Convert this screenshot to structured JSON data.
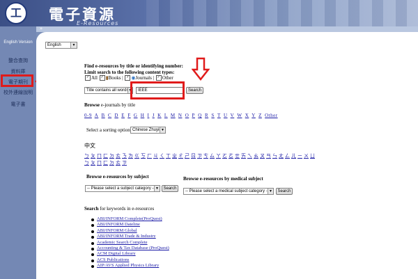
{
  "header": {
    "logo_glyph": "工",
    "title_zh": "電子資源",
    "title_en": "E-Resources"
  },
  "sidebar": {
    "english_version": "English Version",
    "items": [
      {
        "label": "整合查詢"
      },
      {
        "label": "資料庫"
      },
      {
        "label": "電子期刊"
      },
      {
        "label": "校外連線說明"
      },
      {
        "label": "電子書"
      }
    ]
  },
  "language_select": {
    "value": "English"
  },
  "find": {
    "heading": "Find e-resources by title or identifying number:",
    "limit_label": "Limit search to the following content types:",
    "types": [
      "All",
      "Books",
      "Journals",
      "Other"
    ],
    "field_select": "Title contains all words",
    "query": "IEEE",
    "search_label": "Search"
  },
  "browse_title": {
    "heading_bold": "Browse",
    "heading_rest": " e-journals by title",
    "letters": [
      "0-9",
      "A",
      "B",
      "C",
      "D",
      "E",
      "F",
      "G",
      "H",
      "I",
      "J",
      "K",
      "L",
      "M",
      "N",
      "O",
      "P",
      "Q",
      "R",
      "S",
      "T",
      "U",
      "V",
      "W",
      "X",
      "Y",
      "Z",
      "Other"
    ]
  },
  "sorting": {
    "label": "Select a sorting option:",
    "value": "Chinese Zhuyin"
  },
  "zhuyin": {
    "heading": "中文",
    "row1": [
      "ㄅ",
      "ㄆ",
      "ㄇ",
      "ㄈ",
      "ㄉ",
      "ㄊ",
      "ㄋ",
      "ㄌ",
      "ㄍ",
      "ㄎ",
      "ㄏ",
      "ㄐ",
      "ㄑ",
      "ㄒ",
      "ㄓ",
      "ㄔ",
      "ㄕ",
      "ㄖ",
      "ㄗ",
      "ㄘ",
      "ㄙ",
      "ㄚ",
      "ㄛ",
      "ㄜ",
      "ㄝ",
      "ㄞ",
      "ㄟ",
      "ㄠ",
      "ㄡ",
      "ㄢ",
      "ㄣ",
      "ㄤ",
      "ㄥ",
      "ㄦ",
      "ㄧ",
      "ㄨ",
      "ㄩ"
    ],
    "row2": [
      "ㄅ",
      "ㄆ",
      "ㄇ",
      "ㄈ",
      "ㄉ",
      "ㄊ",
      "ㄗ"
    ]
  },
  "browse_subject": {
    "heading": "Browse e-resources by subject",
    "select": "-- Please select a subject category --",
    "search_label": "Search"
  },
  "browse_medical": {
    "heading": "Browse e-resources by medical subject",
    "select": "-- Please select a medical subject category --",
    "search_label": "Search"
  },
  "keywords": {
    "heading_bold": "Search",
    "heading_rest": " for keywords in e-resources",
    "items": [
      "ABI/INFORM Complete(ProQuest)",
      "ABI/INFORM Dateline",
      "ABI/INFORM Global",
      "ABI/INFORM Trade & Industry",
      "Academic Search Complete",
      "Accounting & Tax Database (ProQuest)",
      "ACM Digital Library",
      "ACS Publications",
      "AIP/AVS Applied Physics Library"
    ]
  },
  "colors": {
    "annotation_red": "#e01b1b",
    "link_blue": "#1a1aa6",
    "sidebar_blue": "#7488b4"
  }
}
